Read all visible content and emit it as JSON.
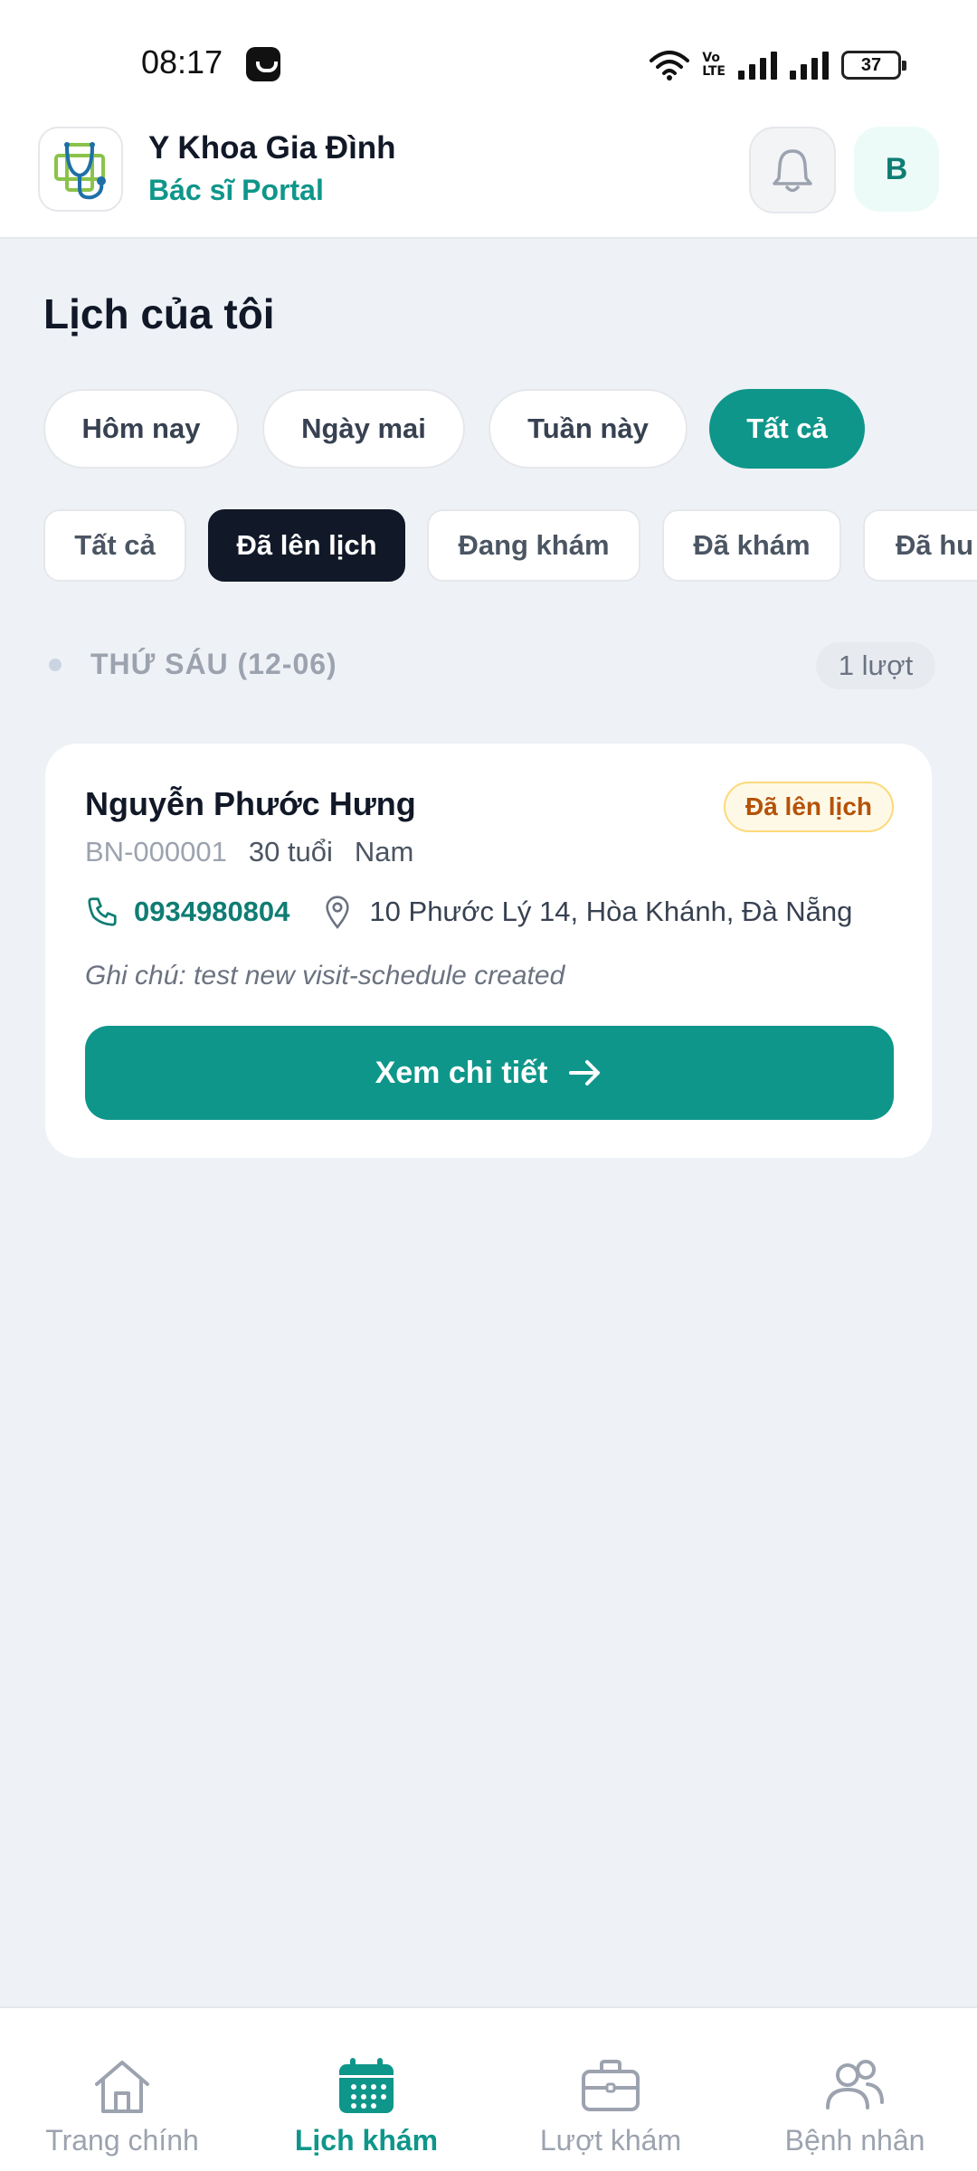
{
  "status_bar": {
    "time": "08:17",
    "battery": "37"
  },
  "header": {
    "app_title": "Y Khoa Gia Đình",
    "app_subtitle": "Bác sĩ Portal",
    "avatar_initial": "B"
  },
  "page": {
    "title": "Lịch của tôi"
  },
  "date_filters": [
    {
      "label": "Hôm nay",
      "active": false
    },
    {
      "label": "Ngày mai",
      "active": false
    },
    {
      "label": "Tuần này",
      "active": false
    },
    {
      "label": "Tất cả",
      "active": true
    }
  ],
  "status_tabs": [
    {
      "label": "Tất cả",
      "active": false
    },
    {
      "label": "Đã lên lịch",
      "active": true
    },
    {
      "label": "Đang khám",
      "active": false
    },
    {
      "label": "Đã khám",
      "active": false
    },
    {
      "label": "Đã hu",
      "active": false
    }
  ],
  "day_group": {
    "label": "THỨ SÁU (12-06)",
    "count": "1 lượt"
  },
  "appointment": {
    "patient_name": "Nguyễn Phước Hưng",
    "status": "Đã lên lịch",
    "patient_id": "BN-000001",
    "age": "30 tuổi",
    "gender": "Nam",
    "phone": "0934980804",
    "address": "10 Phước Lý 14, Hòa Khánh, Đà Nẵng",
    "note": "Ghi chú: test new visit-schedule created",
    "detail_label": "Xem chi tiết"
  },
  "bottom_nav": [
    {
      "label": "Trang chính",
      "icon": "home-icon",
      "active": false
    },
    {
      "label": "Lịch khám",
      "icon": "calendar-icon",
      "active": true
    },
    {
      "label": "Lượt khám",
      "icon": "briefcase-icon",
      "active": false
    },
    {
      "label": "Bệnh nhân",
      "icon": "users-icon",
      "active": false
    }
  ],
  "colors": {
    "primary": "#0f968a",
    "dark": "#111827",
    "background": "#eef2f6",
    "badge_text": "#b45309"
  }
}
